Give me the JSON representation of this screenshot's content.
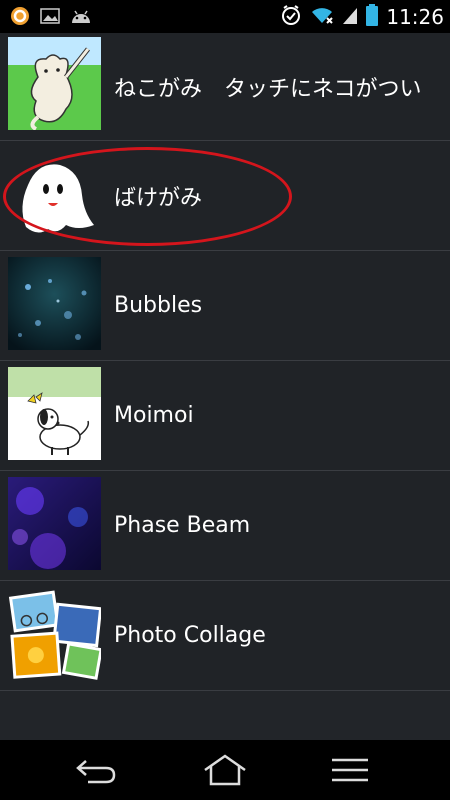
{
  "status_bar": {
    "time": "11:26",
    "left_icons": [
      "notification-circle-icon",
      "image-icon",
      "android-icon"
    ],
    "right_icons": [
      "alarm-icon",
      "wifi-icon",
      "signal-icon",
      "battery-icon"
    ]
  },
  "list": {
    "items": [
      {
        "label": "ねこがみ　タッチにネコがつい",
        "icon": "cat-thumbnail"
      },
      {
        "label": "ばけがみ",
        "icon": "ghost-thumbnail",
        "highlighted": true
      },
      {
        "label": "Bubbles",
        "icon": "bubbles-thumbnail"
      },
      {
        "label": "Moimoi",
        "icon": "dog-thumbnail"
      },
      {
        "label": "Phase Beam",
        "icon": "phase-beam-thumbnail"
      },
      {
        "label": "Photo Collage",
        "icon": "photo-collage-thumbnail"
      }
    ]
  },
  "nav_bar": {
    "buttons": [
      "back-icon",
      "home-icon",
      "menu-icon"
    ]
  },
  "colors": {
    "background": "#222529",
    "highlight": "#d4151c",
    "accent": "#33b5e5"
  }
}
